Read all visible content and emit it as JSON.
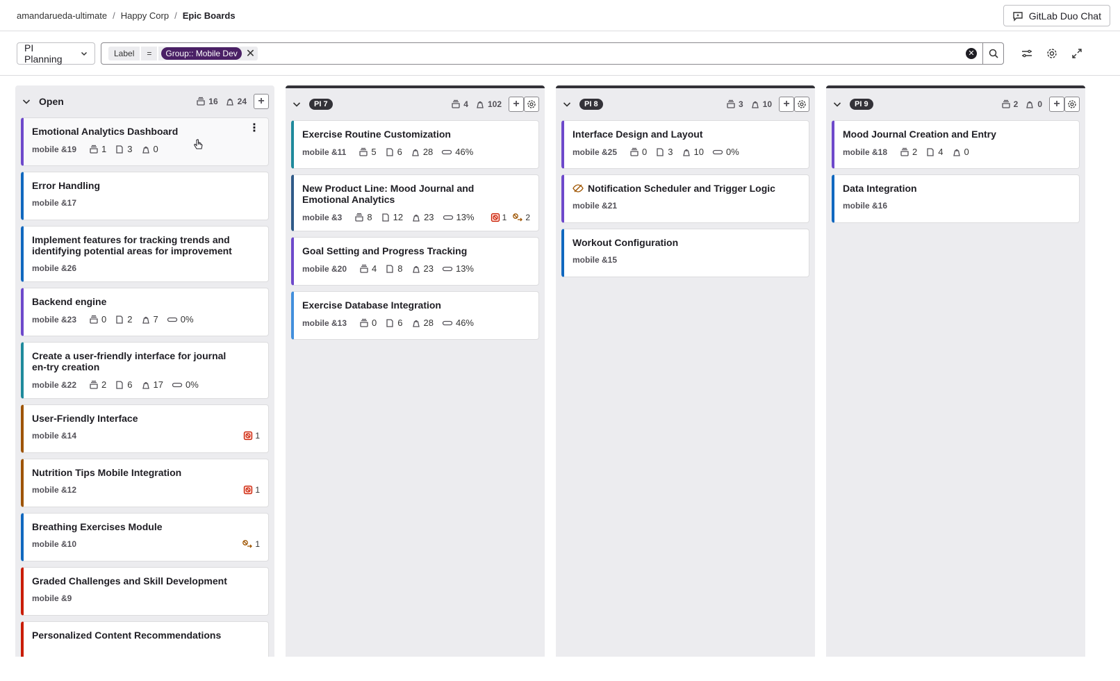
{
  "breadcrumb": [
    "amandarueda-ultimate",
    "Happy Corp",
    "Epic Boards"
  ],
  "duo_button": "GitLab Duo Chat",
  "board_select": "PI Planning",
  "filter": {
    "key": "Label",
    "op": "=",
    "value": "Group:: Mobile Dev"
  },
  "colors": {
    "purple": "#6e49cb",
    "blue": "#1068bf",
    "teal": "#1f8a9c",
    "lightblue": "#428fdc",
    "darkblue": "#2f5a88",
    "orange": "#9e5400",
    "red": "#c91c00",
    "badge": "#4a2065"
  },
  "columns": [
    {
      "title": "Open",
      "badge": false,
      "epics": "16",
      "weight": "24",
      "settings": false,
      "cards": [
        {
          "title": "Emotional Analytics Dashboard",
          "ref": "mobile &19",
          "color": "purple",
          "meta": [
            [
              "epic",
              "1"
            ],
            [
              "issue",
              "3"
            ],
            [
              "weight",
              "0"
            ]
          ],
          "flags": [],
          "hover": true
        },
        {
          "title": "Error Handling",
          "ref": "mobile &17",
          "color": "blue",
          "meta": [],
          "flags": []
        },
        {
          "title": "Implement features for tracking trends and identifying potential areas for improvement",
          "ref": "mobile &26",
          "color": "blue",
          "meta": [],
          "flags": []
        },
        {
          "title": "Backend engine",
          "ref": "mobile &23",
          "color": "purple",
          "meta": [
            [
              "epic",
              "0"
            ],
            [
              "issue",
              "2"
            ],
            [
              "weight",
              "7"
            ],
            [
              "progress",
              "0%"
            ]
          ],
          "flags": []
        },
        {
          "title": "Create a user-friendly interface for journal en-try creation",
          "ref": "mobile &22",
          "color": "teal",
          "meta": [
            [
              "epic",
              "2"
            ],
            [
              "issue",
              "6"
            ],
            [
              "weight",
              "17"
            ],
            [
              "progress",
              "0%"
            ]
          ],
          "flags": []
        },
        {
          "title": "User-Friendly Interface",
          "ref": "mobile &14",
          "color": "orange",
          "meta": [],
          "flags": [
            [
              "blocked",
              "1"
            ]
          ]
        },
        {
          "title": "Nutrition Tips Mobile Integration",
          "ref": "mobile &12",
          "color": "orange",
          "meta": [],
          "flags": [
            [
              "blocked",
              "1"
            ]
          ]
        },
        {
          "title": "Breathing Exercises Module",
          "ref": "mobile &10",
          "color": "blue",
          "meta": [],
          "flags": [
            [
              "blocking",
              "1"
            ]
          ]
        },
        {
          "title": "Graded Challenges and Skill Development",
          "ref": "mobile &9",
          "color": "red",
          "meta": [],
          "flags": []
        },
        {
          "title": "Personalized Content Recommendations",
          "ref": "",
          "color": "red",
          "meta": [],
          "flags": []
        }
      ]
    },
    {
      "title": "PI 7",
      "badge": true,
      "epics": "4",
      "weight": "102",
      "settings": true,
      "cards": [
        {
          "title": "Exercise Routine Customization",
          "ref": "mobile &11",
          "color": "teal",
          "meta": [
            [
              "epic",
              "5"
            ],
            [
              "issue",
              "6"
            ],
            [
              "weight",
              "28"
            ],
            [
              "progress",
              "46%"
            ]
          ],
          "flags": []
        },
        {
          "title": "New Product Line: Mood Journal and Emotional Analytics",
          "ref": "mobile &3",
          "color": "darkblue",
          "meta": [
            [
              "epic",
              "8"
            ],
            [
              "issue",
              "12"
            ],
            [
              "weight",
              "23"
            ],
            [
              "progress",
              "13%"
            ]
          ],
          "flags": [
            [
              "blocked",
              "1"
            ],
            [
              "blocking",
              "2"
            ]
          ]
        },
        {
          "title": "Goal Setting and Progress Tracking",
          "ref": "mobile &20",
          "color": "purple",
          "meta": [
            [
              "epic",
              "4"
            ],
            [
              "issue",
              "8"
            ],
            [
              "weight",
              "23"
            ],
            [
              "progress",
              "13%"
            ]
          ],
          "flags": []
        },
        {
          "title": "Exercise Database Integration",
          "ref": "mobile &13",
          "color": "lightblue",
          "meta": [
            [
              "epic",
              "0"
            ],
            [
              "issue",
              "6"
            ],
            [
              "weight",
              "28"
            ],
            [
              "progress",
              "46%"
            ]
          ],
          "flags": []
        }
      ]
    },
    {
      "title": "PI 8",
      "badge": true,
      "epics": "3",
      "weight": "10",
      "settings": true,
      "cards": [
        {
          "title": "Interface Design and Layout",
          "ref": "mobile &25",
          "color": "purple",
          "meta": [
            [
              "epic",
              "0"
            ],
            [
              "issue",
              "3"
            ],
            [
              "weight",
              "10"
            ],
            [
              "progress",
              "0%"
            ]
          ],
          "flags": []
        },
        {
          "title": "Notification Scheduler and Trigger Logic",
          "ref": "mobile &21",
          "color": "purple",
          "meta": [],
          "flags": [],
          "hidden": true
        },
        {
          "title": "Workout Configuration",
          "ref": "mobile &15",
          "color": "blue",
          "meta": [],
          "flags": []
        }
      ]
    },
    {
      "title": "PI 9",
      "badge": true,
      "epics": "2",
      "weight": "0",
      "settings": true,
      "cards": [
        {
          "title": "Mood Journal Creation and Entry",
          "ref": "mobile &18",
          "color": "purple",
          "meta": [
            [
              "epic",
              "2"
            ],
            [
              "issue",
              "4"
            ],
            [
              "weight",
              "0"
            ]
          ],
          "flags": []
        },
        {
          "title": "Data Integration",
          "ref": "mobile &16",
          "color": "blue",
          "meta": [],
          "flags": []
        }
      ]
    }
  ]
}
